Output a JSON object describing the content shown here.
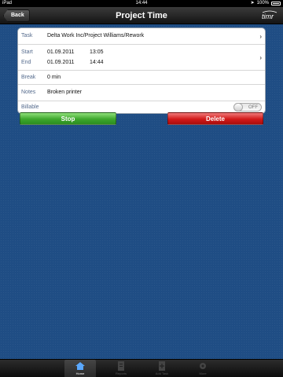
{
  "status_bar": {
    "carrier": "iPad",
    "time": "14:44",
    "battery": "100%"
  },
  "nav": {
    "back_label": "Back",
    "title": "Project Time",
    "logo_text": "timr"
  },
  "entry": {
    "task_label": "Task",
    "task_value": "Delta Work Inc/Project Williams/Rework",
    "start_label": "Start",
    "start_date": "01.09.2011",
    "start_time": "13:05",
    "end_label": "End",
    "end_date": "01.09.2011",
    "end_time": "14:44",
    "break_label": "Break",
    "break_value": "0 min",
    "notes_label": "Notes",
    "notes_value": "Broken printer",
    "billable_label": "Billable",
    "billable_value": "OFF"
  },
  "buttons": {
    "stop_label": "Stop",
    "delete_label": "Delete"
  },
  "tabs": [
    {
      "label": "Home",
      "icon": "home-icon",
      "active": true
    },
    {
      "label": "Reports",
      "icon": "reports-icon",
      "active": false
    },
    {
      "label": "Add Task",
      "icon": "add-task-icon",
      "active": false
    },
    {
      "label": "More",
      "icon": "more-icon",
      "active": false
    }
  ],
  "colors": {
    "background": "#1f4d84",
    "stop": "#3da72d",
    "delete": "#d21a1a"
  }
}
